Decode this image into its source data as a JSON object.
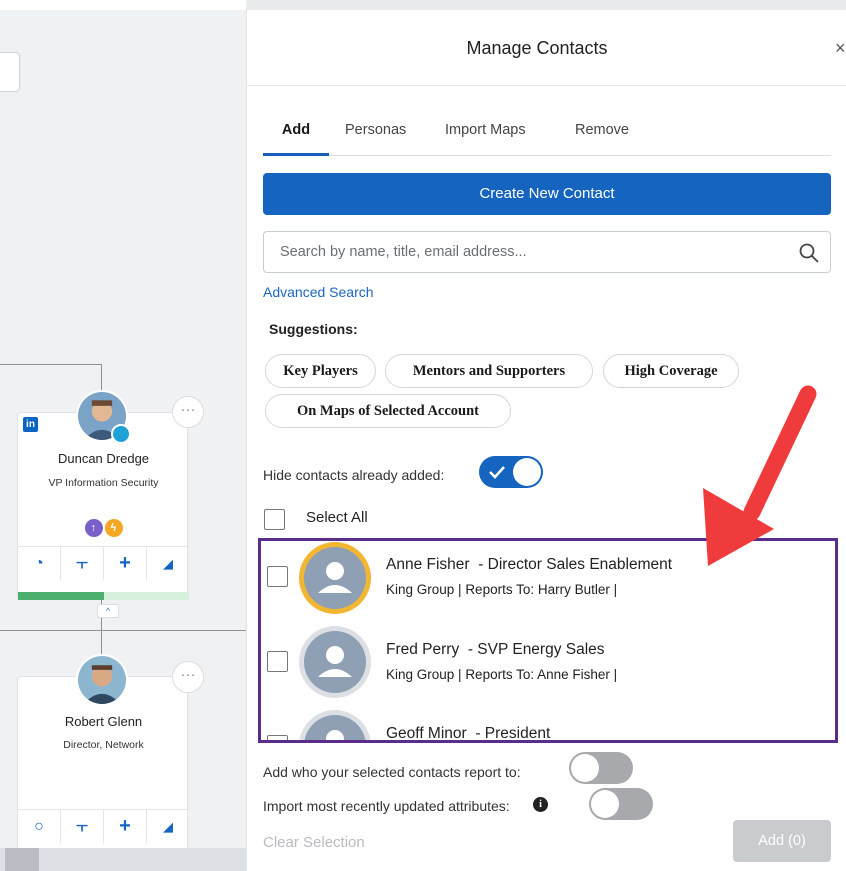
{
  "panel": {
    "title": "Manage Contacts",
    "tabs": [
      {
        "label": "Add",
        "active": true
      },
      {
        "label": "Personas",
        "active": false
      },
      {
        "label": "Import Maps",
        "active": false
      },
      {
        "label": "Remove",
        "active": false
      }
    ],
    "create_button": "Create New Contact",
    "search": {
      "placeholder": "Search by name, title, email address...",
      "value": ""
    },
    "advanced_search": "Advanced Search",
    "suggestions_label": "Suggestions:",
    "suggestions": [
      "Key Players",
      "Mentors and Supporters",
      "High Coverage",
      "On Maps of Selected Account"
    ],
    "hide_contacts": {
      "label": "Hide contacts already added:",
      "on": true
    },
    "select_all": "Select All",
    "contacts": [
      {
        "name": "Anne Fisher",
        "title": "- Director Sales Enablement",
        "company": "King Group",
        "reports_to": "Reports To: Harry Butler",
        "highlight_color": "#f2b632"
      },
      {
        "name": "Fred Perry",
        "title": "- SVP Energy Sales",
        "company": "King Group",
        "reports_to": "Reports To: Anne Fisher",
        "highlight_color": "#b9bcc1"
      },
      {
        "name": "Geoff Minor",
        "title": "- President",
        "company": "",
        "reports_to": "",
        "highlight_color": "#b9bcc1"
      }
    ],
    "add_report_to": {
      "label": "Add who your selected contacts report to:",
      "on": false
    },
    "import_attributes": {
      "label": "Import most recently updated attributes:",
      "on": false
    },
    "clear_selection": "Clear Selection",
    "add_button": "Add (0)"
  },
  "org_chart": {
    "nodes": [
      {
        "name": "Duncan Dredge",
        "title": "VP Information Security",
        "progress": 0.5
      },
      {
        "name": "Robert Glenn",
        "title": "Director, Network"
      }
    ]
  },
  "colors": {
    "primary": "#1565c0",
    "frame": "#5b2c8a",
    "arrow": "#ef3b3b",
    "persona_purple": "#7b5fc9",
    "persona_orange": "#f5a623"
  }
}
